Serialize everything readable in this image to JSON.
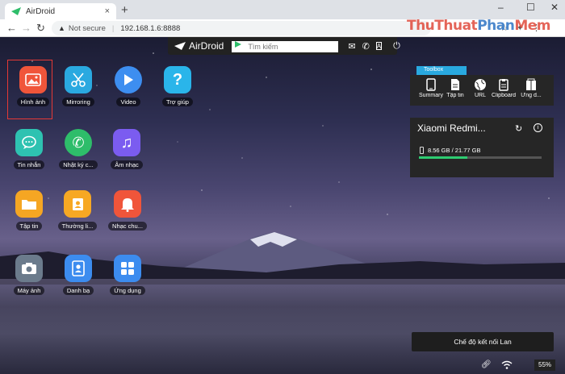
{
  "browser": {
    "tab_title": "AirDroid",
    "tab_close": "×",
    "new_tab": "+",
    "window_controls": [
      "–",
      "☐",
      "✕"
    ],
    "security_label": "Not secure",
    "url": "192.168.1.6:8888",
    "watermark": {
      "part1": "ThuThuat",
      "part2": "Phan",
      "part3": "Mem"
    }
  },
  "airdroid_bar": {
    "logo_text": "AirDroid",
    "search_placeholder": "Tìm kiếm",
    "icons": [
      "mail-icon",
      "phone-icon",
      "font-icon",
      "power-icon"
    ]
  },
  "apps": [
    {
      "label": "Hình ảnh",
      "icon": "image-icon",
      "color": "#f0553a",
      "selected": true
    },
    {
      "label": "Mirroring",
      "icon": "scissors-icon",
      "color": "#2aa9e0"
    },
    {
      "label": "Video",
      "icon": "play-icon",
      "color": "#3d8ef0"
    },
    {
      "label": "Trợ giúp",
      "icon": "help-icon",
      "color": "#2ab5ea"
    },
    {
      "label": "Tin nhắn",
      "icon": "message-icon",
      "color": "#2ec2b1"
    },
    {
      "label": "Nhật ký c...",
      "icon": "call-icon",
      "color": "#2ebd6a"
    },
    {
      "label": "Âm nhạc",
      "icon": "music-icon",
      "color": "#7b5cf0"
    },
    {
      "label": "Tập tin",
      "icon": "folder-icon",
      "color": "#f5a623"
    },
    {
      "label": "Thường li...",
      "icon": "contacts-card-icon",
      "color": "#f7a823"
    },
    {
      "label": "Nhạc chu...",
      "icon": "bell-icon",
      "color": "#f0553a"
    },
    {
      "label": "Máy ảnh",
      "icon": "camera-icon",
      "color": "#6b7b8c"
    },
    {
      "label": "Danh bạ",
      "icon": "contact-icon",
      "color": "#3c8cef"
    },
    {
      "label": "Ứng dụng",
      "icon": "apps-grid-icon",
      "color": "#3c8cef"
    }
  ],
  "toolbox": {
    "tag": "Toolbox",
    "items": [
      {
        "label": "Summary",
        "icon": "phone-summary-icon"
      },
      {
        "label": "Tập tin",
        "icon": "file-icon"
      },
      {
        "label": "URL",
        "icon": "globe-icon"
      },
      {
        "label": "Clipboard",
        "icon": "clipboard-icon"
      },
      {
        "label": "Ứng d...",
        "icon": "app-icon"
      }
    ]
  },
  "device": {
    "name": "Xiaomi Redmi...",
    "storage": "8.56 GB / 21.77 GB",
    "storage_used_fraction": 0.393
  },
  "status": {
    "lan_mode": "Chế độ kết nối Lan",
    "battery": "55%"
  }
}
